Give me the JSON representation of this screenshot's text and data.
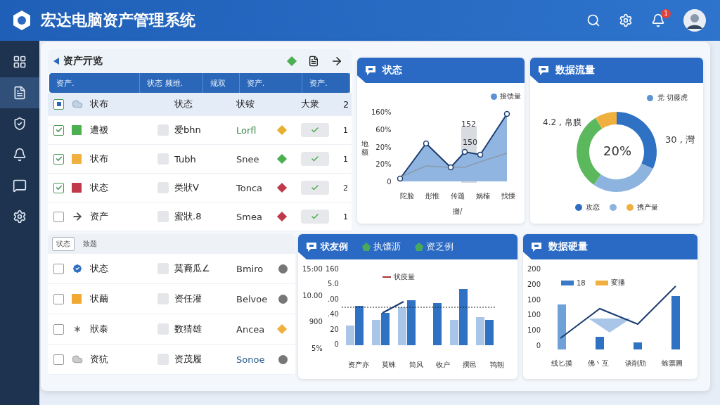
{
  "header": {
    "title": "宏达电脑资产管理系统",
    "notification_count": "1"
  },
  "sidebar": {
    "items": [
      {
        "selected": false
      },
      {
        "selected": true
      },
      {
        "selected": false
      },
      {
        "selected": false
      },
      {
        "selected": false
      },
      {
        "selected": false
      }
    ]
  },
  "asset_table": {
    "title": "资产亓览",
    "columns": [
      "资产.",
      "状态 频维.",
      "规双",
      "资产.",
      "资产."
    ],
    "header_row": {
      "checked": true,
      "cells": [
        "状布",
        "状态",
        "状铵",
        "大衆",
        "2"
      ]
    },
    "rows": [
      {
        "checked": true,
        "icon": {
          "kind": "square",
          "color": "#4caf50"
        },
        "name": "遭袯",
        "tag": "爱bhn",
        "code": "Lorfl",
        "status": {
          "color": "#e8b030"
        },
        "value": "1"
      },
      {
        "checked": true,
        "icon": {
          "kind": "square",
          "color": "#f0b040"
        },
        "name": "状布",
        "tag": "Tubh",
        "code": "Snee",
        "status": {
          "color": "#4caf50"
        },
        "value": "1"
      },
      {
        "checked": true,
        "icon": {
          "kind": "square",
          "color": "#c0394b"
        },
        "name": "状态",
        "tag": "类狀V",
        "code": "Tonca",
        "status": {
          "color": "#c0394b"
        },
        "value": "2"
      },
      {
        "checked": false,
        "icon": {
          "kind": "arrow"
        },
        "name": "资产",
        "tag": "蜜狀.8",
        "code": "Smea",
        "status": {
          "color": "#c0394b"
        },
        "value": "1"
      }
    ]
  },
  "list_panel": {
    "tabs": [
      {
        "label": "状态",
        "selected": true
      },
      {
        "label": "致题",
        "selected": false
      }
    ],
    "rows": [
      {
        "checked": false,
        "icon": {
          "kind": "badge"
        },
        "name": "状态",
        "tag": "莫裔瓜∠",
        "code": "Bmiro",
        "marker": {
          "kind": "dot",
          "color": "#777777"
        }
      },
      {
        "checked": false,
        "icon": {
          "kind": "square",
          "color": "#f0a830"
        },
        "name": "状繭",
        "tag": "资任灌",
        "code": "Belvoe",
        "marker": {
          "kind": "dot",
          "color": "#777777"
        }
      },
      {
        "checked": false,
        "icon": {
          "kind": "asterisk"
        },
        "name": "狀泰",
        "tag": "数猜雄",
        "code": "Ancea",
        "marker": {
          "kind": "diamond",
          "color": "#f0b040"
        }
      },
      {
        "checked": false,
        "icon": {
          "kind": "cloud"
        },
        "name": "资犺",
        "tag": "资茂履",
        "code": "Sonoe",
        "marker": {
          "kind": "dot",
          "color": "#777777"
        }
      }
    ]
  },
  "line_card": {
    "title": "状态",
    "legend": "接馈量",
    "y_labels": [
      "160%",
      "60%",
      "20%",
      "20%",
      "0"
    ],
    "y_title": "地额",
    "x_labels": [
      "陀脸",
      "彤惟",
      "传题",
      "娲楠",
      "找慄"
    ],
    "x_title": "攤/",
    "annotations": [
      "152",
      "150"
    ]
  },
  "donut_card": {
    "title": "数据流量",
    "legend_top": "党 切藤虎",
    "center": "20%",
    "left_label": "4.2 , 帛膜",
    "right_label": "30 , 灣",
    "legend": [
      {
        "label": "攻恋",
        "color": "#2f6fc0"
      },
      {
        "color": "#8db4de"
      },
      {
        "label": "携产量",
        "color": "#f0b040"
      }
    ]
  },
  "bar_card": {
    "tabs": [
      {
        "label": "状友例",
        "selected": true
      },
      {
        "label": "执馕沥",
        "selected": false
      },
      {
        "label": "资乏例",
        "selected": false
      }
    ],
    "y_outer": [
      "15:00",
      "10.00",
      "900",
      "5%"
    ],
    "y_inner": [
      "160",
      "5.0",
      ".00",
      ".40",
      "20",
      "0"
    ],
    "legend": "状疫量",
    "x_labels": [
      "资产亦",
      "莫蛛",
      "筒风",
      "收户",
      "撰邑",
      "鸨朝"
    ]
  },
  "combo_card": {
    "title": "数据硬量",
    "y_labels": [
      "200",
      "200",
      "100",
      "100",
      "100",
      "0"
    ],
    "legend": [
      {
        "label": "18",
        "color": "#3a78c8"
      },
      {
        "label": "変播",
        "color": "#f0b040"
      }
    ],
    "x_labels": [
      "线匕摸",
      "佛丶互",
      "谈削劤",
      "蜍票圖"
    ]
  }
}
